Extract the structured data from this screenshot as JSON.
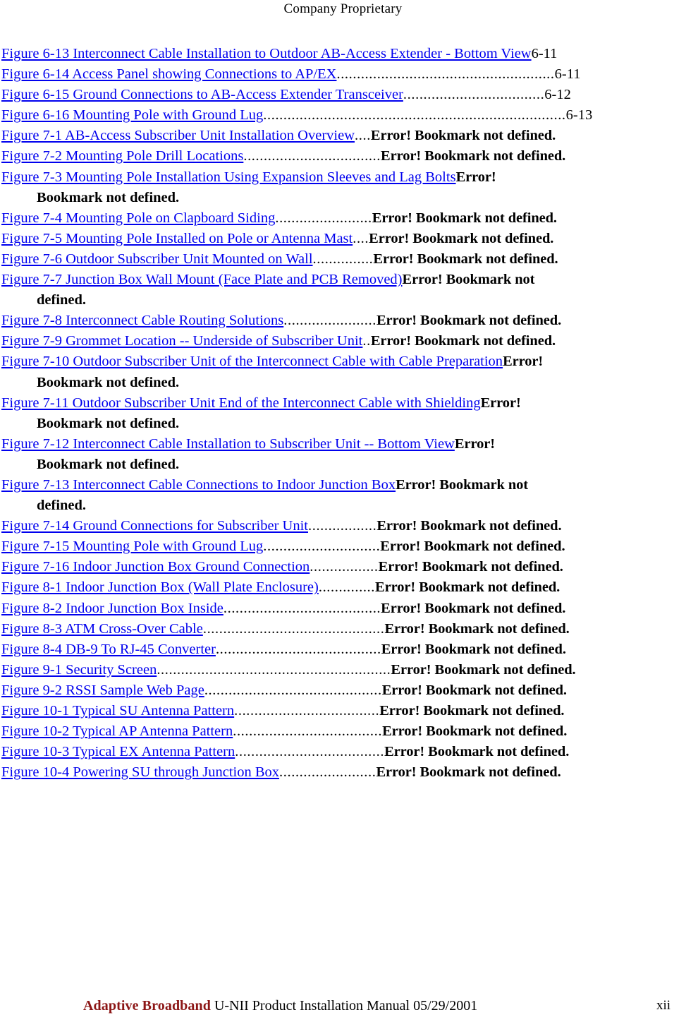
{
  "header": {
    "text": "Company Proprietary"
  },
  "colors": {
    "link": "#0000EE",
    "text": "#000000",
    "brand": "#8C1616",
    "background": "#FFFFFF"
  },
  "table_of_figures": {
    "entries": [
      {
        "caption": "Figure 6-13  Interconnect Cable Installation to Outdoor AB-Access Extender - Bottom View",
        "leader": "",
        "page": "6-11",
        "continuation": ""
      },
      {
        "caption": "Figure 6-14  Access Panel  showing Connections to AP/EX",
        "leader": "......................................................",
        "page": "6-11",
        "continuation": ""
      },
      {
        "caption": "Figure 6-15  Ground Connections to AB-Access Extender Transceiver",
        "leader": "...................................",
        "page": "6-12",
        "continuation": ""
      },
      {
        "caption": "Figure 6-16  Mounting Pole with Ground Lug",
        "leader": "...........................................................................",
        "page": "6-13",
        "continuation": ""
      },
      {
        "caption": "Figure 7-1  AB-Access Subscriber Unit Installation Overview",
        "leader": "....",
        "page": "Error! Bookmark not defined.",
        "continuation": ""
      },
      {
        "caption": "Figure 7-2   Mounting Pole Drill Locations",
        "leader": "..................................",
        "page": "Error! Bookmark not defined.",
        "continuation": ""
      },
      {
        "caption": "Figure 7-3 Mounting Pole Installation Using Expansion Sleeves and Lag Bolts",
        "leader": "",
        "page": "Error!",
        "continuation": "Bookmark not defined."
      },
      {
        "caption": "Figure 7-4   Mounting Pole on Clapboard Siding",
        "leader": "........................",
        "page": "Error! Bookmark not defined.",
        "continuation": ""
      },
      {
        "caption": "Figure 7-5  Mounting Pole Installed on Pole or Antenna Mast",
        "leader": "....",
        "page": "Error! Bookmark not defined.",
        "continuation": ""
      },
      {
        "caption": "Figure 7-6  Outdoor Subscriber Unit Mounted on Wall",
        "leader": "...............",
        "page": "Error! Bookmark not defined.",
        "continuation": ""
      },
      {
        "caption": "Figure 7-7  Junction Box Wall Mount (Face Plate and PCB Removed)",
        "leader": "",
        "page": "Error! Bookmark not",
        "continuation": "defined."
      },
      {
        "caption": "Figure 7-8  Interconnect Cable Routing Solutions",
        "leader": ".......................",
        "page": "Error! Bookmark not defined.",
        "continuation": ""
      },
      {
        "caption": "Figure 7-9  Grommet Location -- Underside of Subscriber Unit",
        "leader": "..",
        "page": "Error! Bookmark not defined.",
        "continuation": ""
      },
      {
        "caption": "Figure 7-10  Outdoor Subscriber Unit of the Interconnect Cable with Cable Preparation",
        "leader": "",
        "page": "Error!",
        "continuation": "Bookmark not defined."
      },
      {
        "caption": "Figure 7-11  Outdoor Subscriber Unit End of the Interconnect Cable with Shielding",
        "leader": "",
        "page": "Error!",
        "continuation": "Bookmark not defined."
      },
      {
        "caption": "Figure 7-12  Interconnect Cable Installation to Subscriber Unit -- Bottom View",
        "leader": "",
        "page": "Error!",
        "continuation": "Bookmark not defined."
      },
      {
        "caption": "Figure 7-13  Interconnect Cable Connections to Indoor Junction Box",
        "leader": "",
        "page": "Error! Bookmark not",
        "continuation": "defined."
      },
      {
        "caption": "Figure 7-14  Ground Connections for Subscriber Unit",
        "leader": ".................",
        "page": "Error! Bookmark not defined.",
        "continuation": ""
      },
      {
        "caption": "Figure 7-15  Mounting Pole with Ground Lug",
        "leader": ".............................",
        "page": "Error! Bookmark not defined.",
        "continuation": ""
      },
      {
        "caption": "Figure 7-16  Indoor Junction Box Ground Connection",
        "leader": ".................",
        "page": "Error! Bookmark not defined.",
        "continuation": ""
      },
      {
        "caption": "Figure 8-1  Indoor Junction Box (Wall Plate Enclosure)",
        "leader": "..............",
        "page": "Error! Bookmark not defined.",
        "continuation": ""
      },
      {
        "caption": "Figure 8-2  Indoor Junction Box  Inside",
        "leader": ".......................................",
        "page": "Error! Bookmark not defined.",
        "continuation": ""
      },
      {
        "caption": "Figure 8-3  ATM Cross-Over Cable",
        "leader": ".............................................",
        "page": "Error! Bookmark not defined.",
        "continuation": ""
      },
      {
        "caption": "Figure 8-4  DB-9 To RJ-45 Converter",
        "leader": ".........................................",
        "page": "Error! Bookmark not defined.",
        "continuation": ""
      },
      {
        "caption": "Figure 9-1  Security Screen",
        "leader": "..........................................................",
        "page": "Error! Bookmark not defined.",
        "continuation": ""
      },
      {
        "caption": "Figure 9-2  RSSI Sample Web Page",
        "leader": "............................................",
        "page": "Error! Bookmark not defined.",
        "continuation": ""
      },
      {
        "caption": "Figure 10-1  Typical SU Antenna Pattern",
        "leader": "....................................",
        "page": "Error! Bookmark not defined.",
        "continuation": ""
      },
      {
        "caption": "Figure 10-2 Typical AP Antenna Pattern",
        "leader": ".....................................",
        "page": "Error! Bookmark not defined.",
        "continuation": ""
      },
      {
        "caption": "Figure 10-3 Typical EX Antenna Pattern",
        "leader": ".....................................",
        "page": "Error! Bookmark not defined.",
        "continuation": ""
      },
      {
        "caption": "Figure 10-4  Powering SU through Junction Box",
        "leader": "........................",
        "page": "Error! Bookmark not defined.",
        "continuation": ""
      }
    ]
  },
  "footer": {
    "brand": "Adaptive Broadband",
    "title": "U-NII Product Installation Manual  05/29/2001",
    "page_number": "xii"
  }
}
